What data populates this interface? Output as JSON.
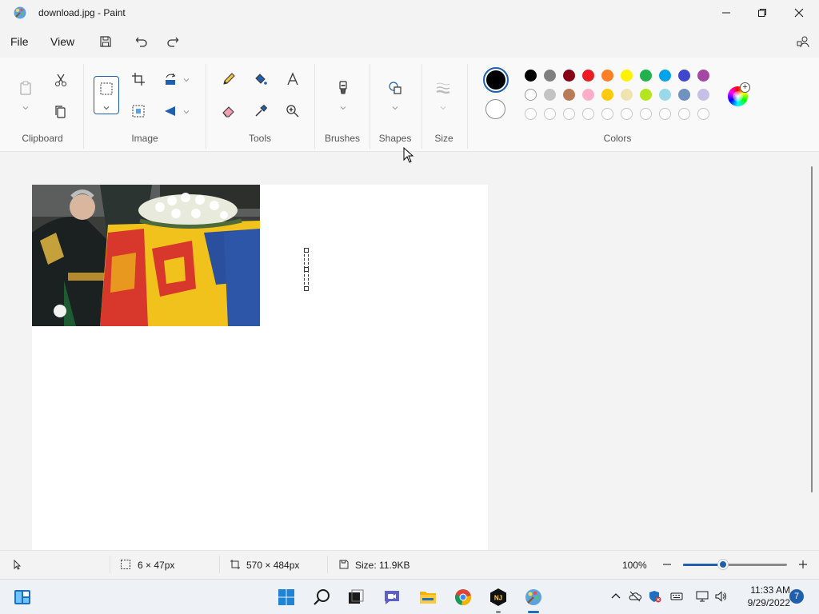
{
  "window": {
    "title": "download.jpg - Paint"
  },
  "menu": {
    "file": "File",
    "view": "View"
  },
  "ribbon": {
    "groups": {
      "clipboard": "Clipboard",
      "image": "Image",
      "tools": "Tools",
      "brushes": "Brushes",
      "shapes": "Shapes",
      "size": "Size",
      "colors": "Colors"
    },
    "primary_color": "#000000",
    "secondary_color": "#ffffff",
    "palette_row1": [
      "#000000",
      "#7f7f7f",
      "#880015",
      "#ed1c24",
      "#ff7f27",
      "#fff200",
      "#22b14c",
      "#00a2e8",
      "#3f48cc",
      "#a349a4"
    ],
    "palette_row2": [
      "#ffffff",
      "#c3c3c3",
      "#b97a57",
      "#ffaec9",
      "#ffc90e",
      "#efe4b0",
      "#b5e61d",
      "#99d9ea",
      "#7092be",
      "#c8bfe7"
    ],
    "palette_row3_empty_count": 10
  },
  "status": {
    "selection_size": "6 × 47px",
    "canvas_size": "570 × 484px",
    "file_size": "Size: 11.9KB",
    "zoom": "100%",
    "zoom_level": 1.0
  },
  "taskbar": {
    "time": "11:33 AM",
    "date": "9/29/2022",
    "notifications": "7",
    "pinned": [
      "widgets",
      "start",
      "search",
      "task-view",
      "teams-chat",
      "file-explorer",
      "chrome",
      "nj-app",
      "paint"
    ]
  },
  "colors": {
    "accent": "#1f5fae"
  }
}
